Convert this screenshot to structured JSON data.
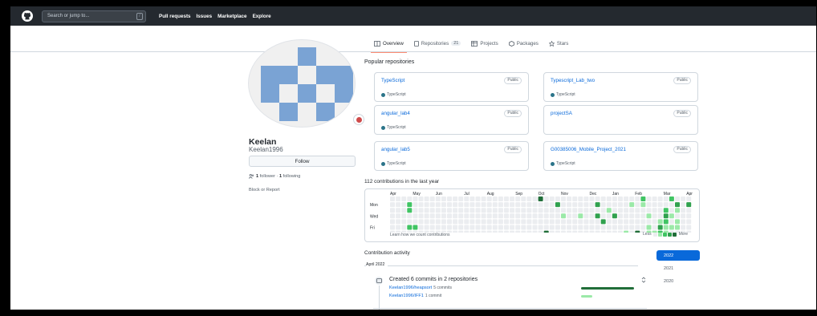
{
  "header": {
    "search_placeholder": "Search or jump to...",
    "search_key": "/",
    "nav": [
      "Pull requests",
      "Issues",
      "Marketplace",
      "Explore"
    ]
  },
  "tabs": [
    {
      "label": "Overview",
      "active": true,
      "icon": "book-icon"
    },
    {
      "label": "Repositories",
      "count": "21",
      "active": false,
      "icon": "repo-icon"
    },
    {
      "label": "Projects",
      "active": false,
      "icon": "table-icon"
    },
    {
      "label": "Packages",
      "active": false,
      "icon": "package-icon"
    },
    {
      "label": "Stars",
      "active": false,
      "icon": "star-icon"
    }
  ],
  "profile": {
    "name": "Keelan",
    "login": "Keelan1996",
    "follow_label": "Follow",
    "followers_count": "1",
    "followers_label": "follower",
    "following_count": "1",
    "following_label": "following",
    "block_label": "Block or Report",
    "avatar_color": "#7aa3d4"
  },
  "popular": {
    "title": "Popular repositories",
    "repos": [
      {
        "name": "TypeScript",
        "visibility": "Public",
        "language": "TypeScript"
      },
      {
        "name": "Typescript_Lab_two",
        "visibility": "Public",
        "language": "TypeScript"
      },
      {
        "name": "angular_lab4",
        "visibility": "Public",
        "language": "TypeScript"
      },
      {
        "name": "projectSA",
        "visibility": "Public",
        "language": ""
      },
      {
        "name": "angular_lab5",
        "visibility": "Public",
        "language": "TypeScript"
      },
      {
        "name": "G00385006_Mobile_Project_2021",
        "visibility": "Public",
        "language": "TypeScript"
      }
    ]
  },
  "contributions": {
    "title": "112 contributions in the last year",
    "months": [
      "Apr",
      "May",
      "Jun",
      "Jul",
      "Aug",
      "Sep",
      "Oct",
      "Nov",
      "Dec",
      "Jan",
      "Feb",
      "Mar",
      "Apr"
    ],
    "days": [
      "Mon",
      "Wed",
      "Fri"
    ],
    "learn_label": "Learn how we count contributions",
    "less_label": "Less",
    "more_label": "More",
    "colors": [
      "#ebedf0",
      "#9be9a8",
      "#40c463",
      "#30a14e",
      "#216e39"
    ]
  },
  "activity": {
    "title": "Contribution activity",
    "month": "April 2022",
    "heading": "Created 6 commits in 2 repositories",
    "rows": [
      {
        "repo": "Keelan1996/heapsort",
        "commits": "5 commits",
        "fraction": 0.83,
        "color": "#216e39"
      },
      {
        "repo": "Keelan1996/IFF1",
        "commits": "1 commit",
        "fraction": 0.17,
        "color": "#9be9a8"
      }
    ]
  },
  "years": [
    "2022",
    "2021",
    "2020"
  ]
}
